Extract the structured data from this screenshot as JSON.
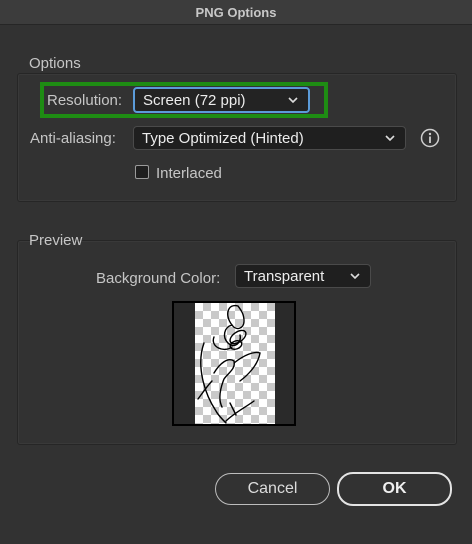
{
  "window": {
    "title": "PNG Options"
  },
  "options": {
    "group_title": "Options",
    "resolution": {
      "label": "Resolution:",
      "value": "Screen (72 ppi)"
    },
    "anti_aliasing": {
      "label": "Anti-aliasing:",
      "value": "Type Optimized (Hinted)"
    },
    "interlaced": {
      "label": "Interlaced",
      "checked": false
    }
  },
  "preview": {
    "group_title": "Preview",
    "background_color": {
      "label": "Background Color:",
      "value": "Transparent"
    }
  },
  "buttons": {
    "cancel": "Cancel",
    "ok": "OK"
  },
  "colors": {
    "highlight": "#1e8c13",
    "focus": "#5b9bd9",
    "background": "#323232"
  },
  "icons": {
    "dropdown": "chevron-down-icon",
    "info": "info-icon",
    "preview_art": "sketch-drawing"
  }
}
